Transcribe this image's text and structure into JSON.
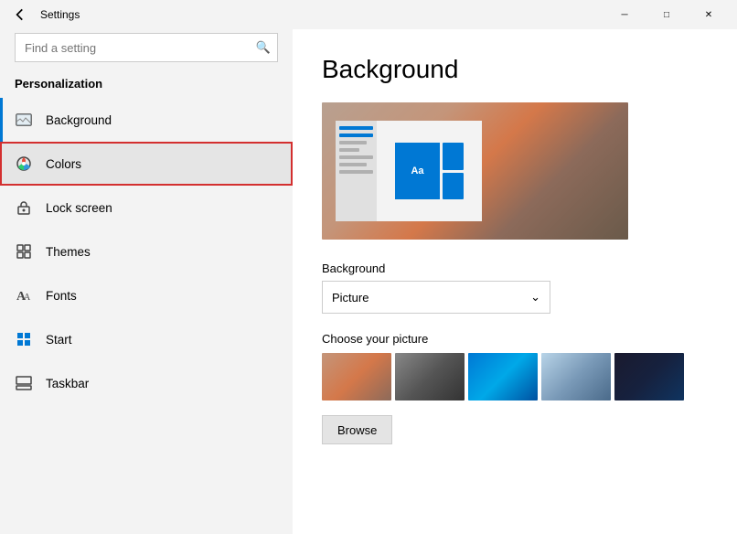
{
  "titlebar": {
    "title": "Settings",
    "back_label": "←",
    "minimize_label": "─",
    "maximize_label": "□",
    "close_label": "✕"
  },
  "sidebar": {
    "search_placeholder": "Find a setting",
    "search_icon": "🔍",
    "section_title": "Personalization",
    "items": [
      {
        "id": "background",
        "label": "Background",
        "icon": "background"
      },
      {
        "id": "colors",
        "label": "Colors",
        "icon": "colors"
      },
      {
        "id": "lockscreen",
        "label": "Lock screen",
        "icon": "lockscreen"
      },
      {
        "id": "themes",
        "label": "Themes",
        "icon": "themes"
      },
      {
        "id": "fonts",
        "label": "Fonts",
        "icon": "fonts"
      },
      {
        "id": "start",
        "label": "Start",
        "icon": "start"
      },
      {
        "id": "taskbar",
        "label": "Taskbar",
        "icon": "taskbar"
      }
    ]
  },
  "content": {
    "title": "Background",
    "bg_section_label": "Background",
    "dropdown_value": "Picture",
    "choose_label": "Choose your picture",
    "browse_label": "Browse"
  }
}
